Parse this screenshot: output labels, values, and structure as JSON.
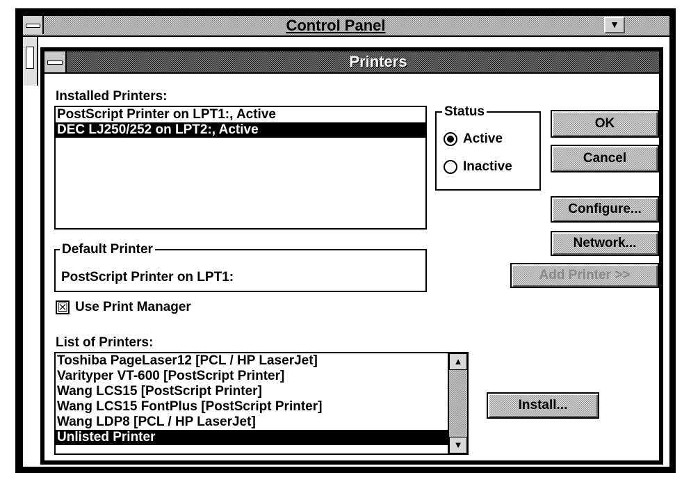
{
  "control_panel": {
    "title": "Control Panel",
    "minimize_glyph": "▼"
  },
  "dialog": {
    "title": "Printers",
    "installed_label": "Installed Printers:",
    "installed": [
      {
        "label": "PostScript Printer on LPT1:, Active",
        "selected": false
      },
      {
        "label": "DEC LJ250/252 on LPT2:, Active",
        "selected": true
      }
    ],
    "status": {
      "title": "Status",
      "options": [
        {
          "label": "Active",
          "selected": true
        },
        {
          "label": "Inactive",
          "selected": false
        }
      ]
    },
    "buttons": {
      "ok": "OK",
      "cancel": "Cancel",
      "configure": "Configure...",
      "network": "Network...",
      "add_printer": "Add Printer >>",
      "install": "Install..."
    },
    "default_printer": {
      "title": "Default Printer",
      "value": "PostScript Printer on LPT1:"
    },
    "use_print_manager": {
      "label": "Use Print Manager",
      "checked": true,
      "glyph": "☒"
    },
    "list_label": "List of Printers:",
    "printer_list": [
      {
        "label": "Toshiba PageLaser12 [PCL / HP LaserJet]",
        "selected": false
      },
      {
        "label": "Varityper VT-600 [PostScript Printer]",
        "selected": false
      },
      {
        "label": "Wang LCS15 [PostScript Printer]",
        "selected": false
      },
      {
        "label": "Wang LCS15 FontPlus [PostScript Printer]",
        "selected": false
      },
      {
        "label": "Wang LDP8 [PCL / HP LaserJet]",
        "selected": false
      },
      {
        "label": "Unlisted Printer",
        "selected": true
      }
    ],
    "scroll_up_glyph": "▲",
    "scroll_down_glyph": "▼"
  }
}
